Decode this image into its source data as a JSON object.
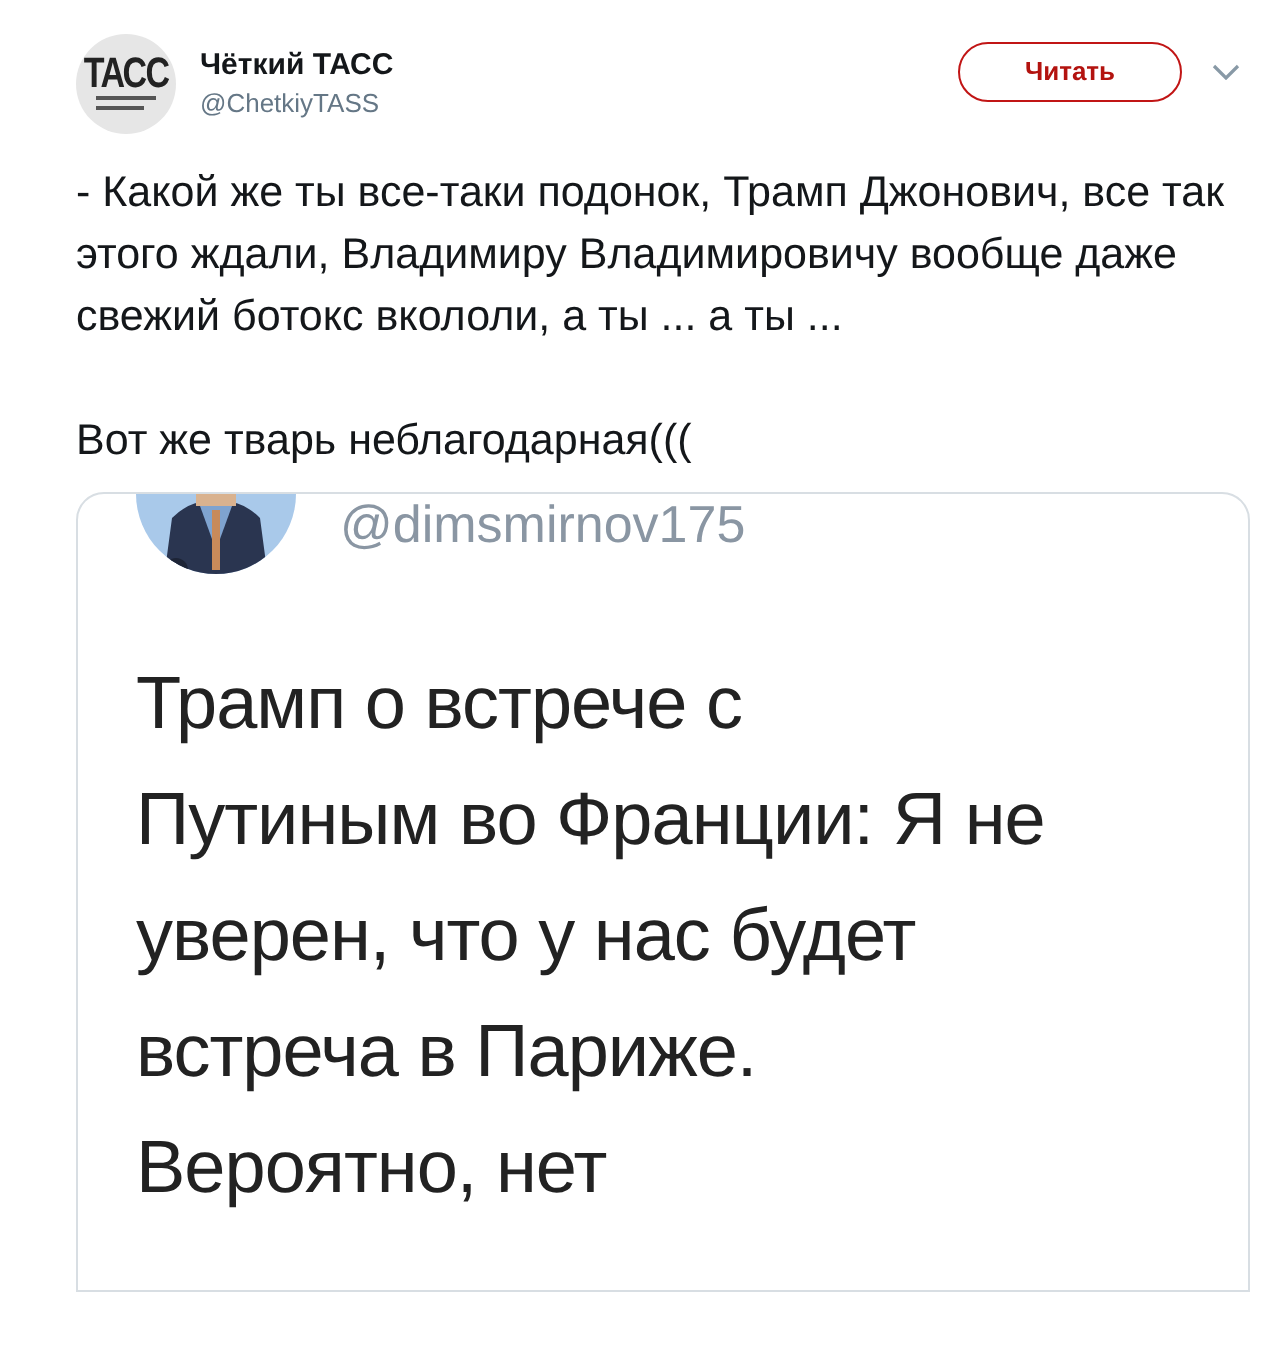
{
  "author": {
    "name": "Чёткий ТАСС",
    "handle": "@ChetkiyTASS",
    "avatar_logo": "ТАСС"
  },
  "follow_button": {
    "label": "Читать"
  },
  "tweet_paragraphs": [
    "-  Какой же ты все-таки подонок, Трамп Джонович, все так этого ждали, Владимиру Владимировичу вообще даже свежий ботокс вкололи, а ты ... а ты ...",
    "Вот же тварь неблагодарная((("
  ],
  "embedded_image": {
    "handle": "@dimsmirnov175",
    "lines": [
      "Трамп о встрече с",
      "Путиным во Франции: Я не",
      "уверен, что у нас будет",
      "встреча в Париже.",
      "Вероятно, нет"
    ]
  }
}
